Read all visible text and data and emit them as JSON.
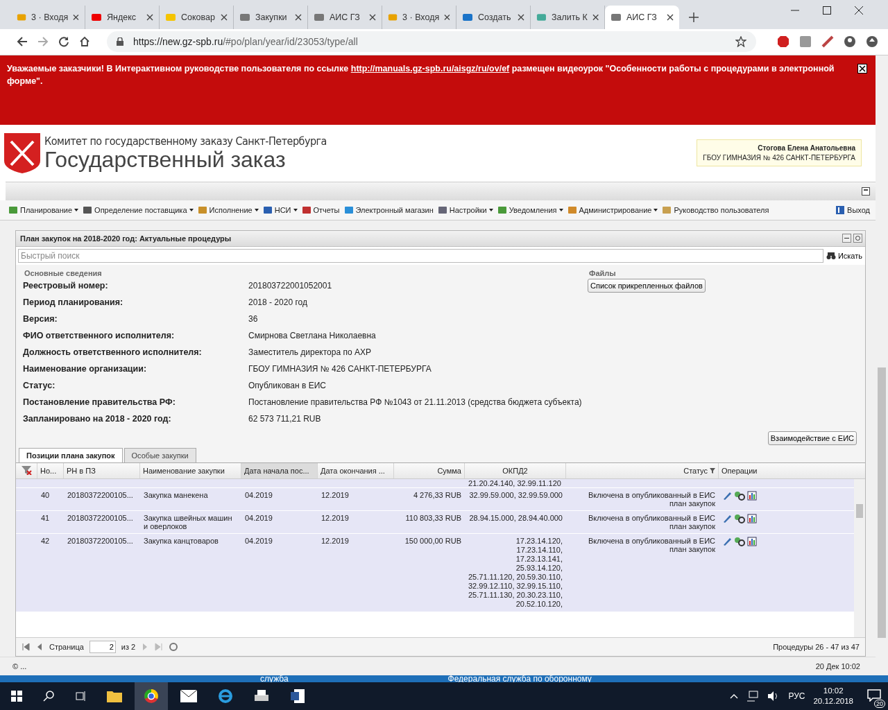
{
  "browser": {
    "tabs": [
      {
        "title": "3 · Входя",
        "selected": false
      },
      {
        "title": "Яндекс",
        "selected": false
      },
      {
        "title": "Соковар",
        "selected": false
      },
      {
        "title": "Закупки",
        "selected": false
      },
      {
        "title": "АИС ГЗ",
        "selected": false
      },
      {
        "title": "3 · Входя",
        "selected": false
      },
      {
        "title": "Создать",
        "selected": false
      },
      {
        "title": "Залить К",
        "selected": false
      },
      {
        "title": "АИС ГЗ",
        "selected": true
      }
    ],
    "url_host": "https://new.gz-spb.ru",
    "url_path": "/#po/plan/year/id/23053/type/all"
  },
  "banner": {
    "before": "Уважаемые заказчики! В Интерактивном руководстве пользователя по ссылке ",
    "link": "http://manuals.gz-spb.ru/aisgz/ru/ov/ef",
    "after": " размещен видеоурок \"Особенности работы с процедурами в электронной форме\"."
  },
  "header": {
    "org": "Комитет по государственному заказу Санкт-Петербурга",
    "title": "Государственный заказ",
    "user_name": "Стогова Елена Анатольевна",
    "user_org": "ГБОУ ГИМНАЗИЯ № 426 САНКТ-ПЕТЕРБУРГА"
  },
  "menu": {
    "items": [
      {
        "label": "Планирование",
        "dropdown": true
      },
      {
        "label": "Определение поставщика",
        "dropdown": true
      },
      {
        "label": "Исполнение",
        "dropdown": true
      },
      {
        "label": "НСИ",
        "dropdown": true
      },
      {
        "label": "Отчеты",
        "dropdown": false
      },
      {
        "label": "Электронный магазин",
        "dropdown": false
      },
      {
        "label": "Настройки",
        "dropdown": true
      },
      {
        "label": "Уведомления",
        "dropdown": true
      },
      {
        "label": "Администрирование",
        "dropdown": true
      },
      {
        "label": "Руководство пользователя",
        "dropdown": false
      }
    ],
    "exit": "Выход"
  },
  "panel": {
    "title": "План закупок на 2018-2020 год: Актуальные процедуры",
    "search_placeholder": "Быстрый поиск",
    "search_button": "Искать",
    "section": "Основные сведения",
    "fields": [
      {
        "label": "Реестровый номер:",
        "value": "201803722001052001"
      },
      {
        "label": "Период планирования:",
        "value": "2018 - 2020 год"
      },
      {
        "label": "Версия:",
        "value": "36"
      },
      {
        "label": "ФИО ответственного исполнителя:",
        "value": "Смирнова Светлана Николаевна"
      },
      {
        "label": "Должность ответственного исполнителя:",
        "value": "Заместитель директора по АХР"
      },
      {
        "label": "Наименование организации:",
        "value": "ГБОУ ГИМНАЗИЯ № 426 САНКТ-ПЕТЕРБУРГА"
      },
      {
        "label": "Статус:",
        "value": "Опубликован в ЕИС"
      },
      {
        "label": "Постановление правительства РФ:",
        "value": "Постановление правительства РФ №1043 от 21.11.2013 (средства бюджета субъекта)"
      },
      {
        "label": "Запланировано на 2018 - 2020 год:",
        "value": "62 573 711,21 RUB"
      }
    ],
    "files_title": "Файлы",
    "files_button": "Список прикрепленных файлов",
    "eis_button": "Взаимодействие с ЕИС"
  },
  "tabs": [
    {
      "label": "Позиции плана закупок",
      "selected": true
    },
    {
      "label": "Особые закупки",
      "selected": false
    }
  ],
  "table": {
    "columns": [
      {
        "label": "Но...",
        "sorted": false
      },
      {
        "label": "РН в ПЗ",
        "sorted": false
      },
      {
        "label": "Наименование закупки",
        "sorted": false
      },
      {
        "label": "Дата начала пос...",
        "sorted": true
      },
      {
        "label": "Дата окончания ...",
        "sorted": false
      },
      {
        "label": "Сумма",
        "sorted": false
      },
      {
        "label": "ОКПД2",
        "sorted": false
      },
      {
        "label": "Статус",
        "sorted": false
      },
      {
        "label": "Операции",
        "sorted": false
      }
    ],
    "partial_okpd": "21.20.24.140, 32.99.11.120",
    "rows": [
      {
        "no": "40",
        "rn": "20180372200105...",
        "name": "Закупка манекена",
        "start": "04.2019",
        "end": "12.2019",
        "sum": "4 276,33 RUB",
        "okpd": [
          "32.99.59.000, 32.99.59.000"
        ],
        "status": "Включена в опубликованный в ЕИС план закупок"
      },
      {
        "no": "41",
        "rn": "20180372200105...",
        "name": "Закупка швейных машин и оверлоков",
        "start": "04.2019",
        "end": "12.2019",
        "sum": "110 803,33 RUB",
        "okpd": [
          "28.94.15.000, 28.94.40.000"
        ],
        "status": "Включена в опубликованный в ЕИС план закупок"
      },
      {
        "no": "42",
        "rn": "20180372200105...",
        "name": "Закупка канцтоваров",
        "start": "04.2019",
        "end": "12.2019",
        "sum": "150 000,00 RUB",
        "okpd": [
          "17.23.14.120,",
          "17.23.14.110,",
          "17.23.13.141,",
          "25.93.14.120,",
          "25.71.11.120, 20.59.30.110,",
          "32.99.12.110, 32.99.15.110,",
          "25.71.11.130, 20.30.23.110,",
          "20.52.10.120,"
        ],
        "status": "Включена в опубликованный в ЕИС план закупок"
      }
    ]
  },
  "pager": {
    "page_label": "Страница",
    "page": "2",
    "of": "из 2",
    "summary": "Процедуры 26 - 47 из 47"
  },
  "footer": {
    "left": "© ...",
    "right": "20 Дек 10:02"
  },
  "desktop_texts": [
    "служба",
    "Федеральная служба по оборонному"
  ],
  "taskbar": {
    "lang": "РУС",
    "time": "10:02",
    "date": "20.12.2018",
    "notifications": "20"
  }
}
